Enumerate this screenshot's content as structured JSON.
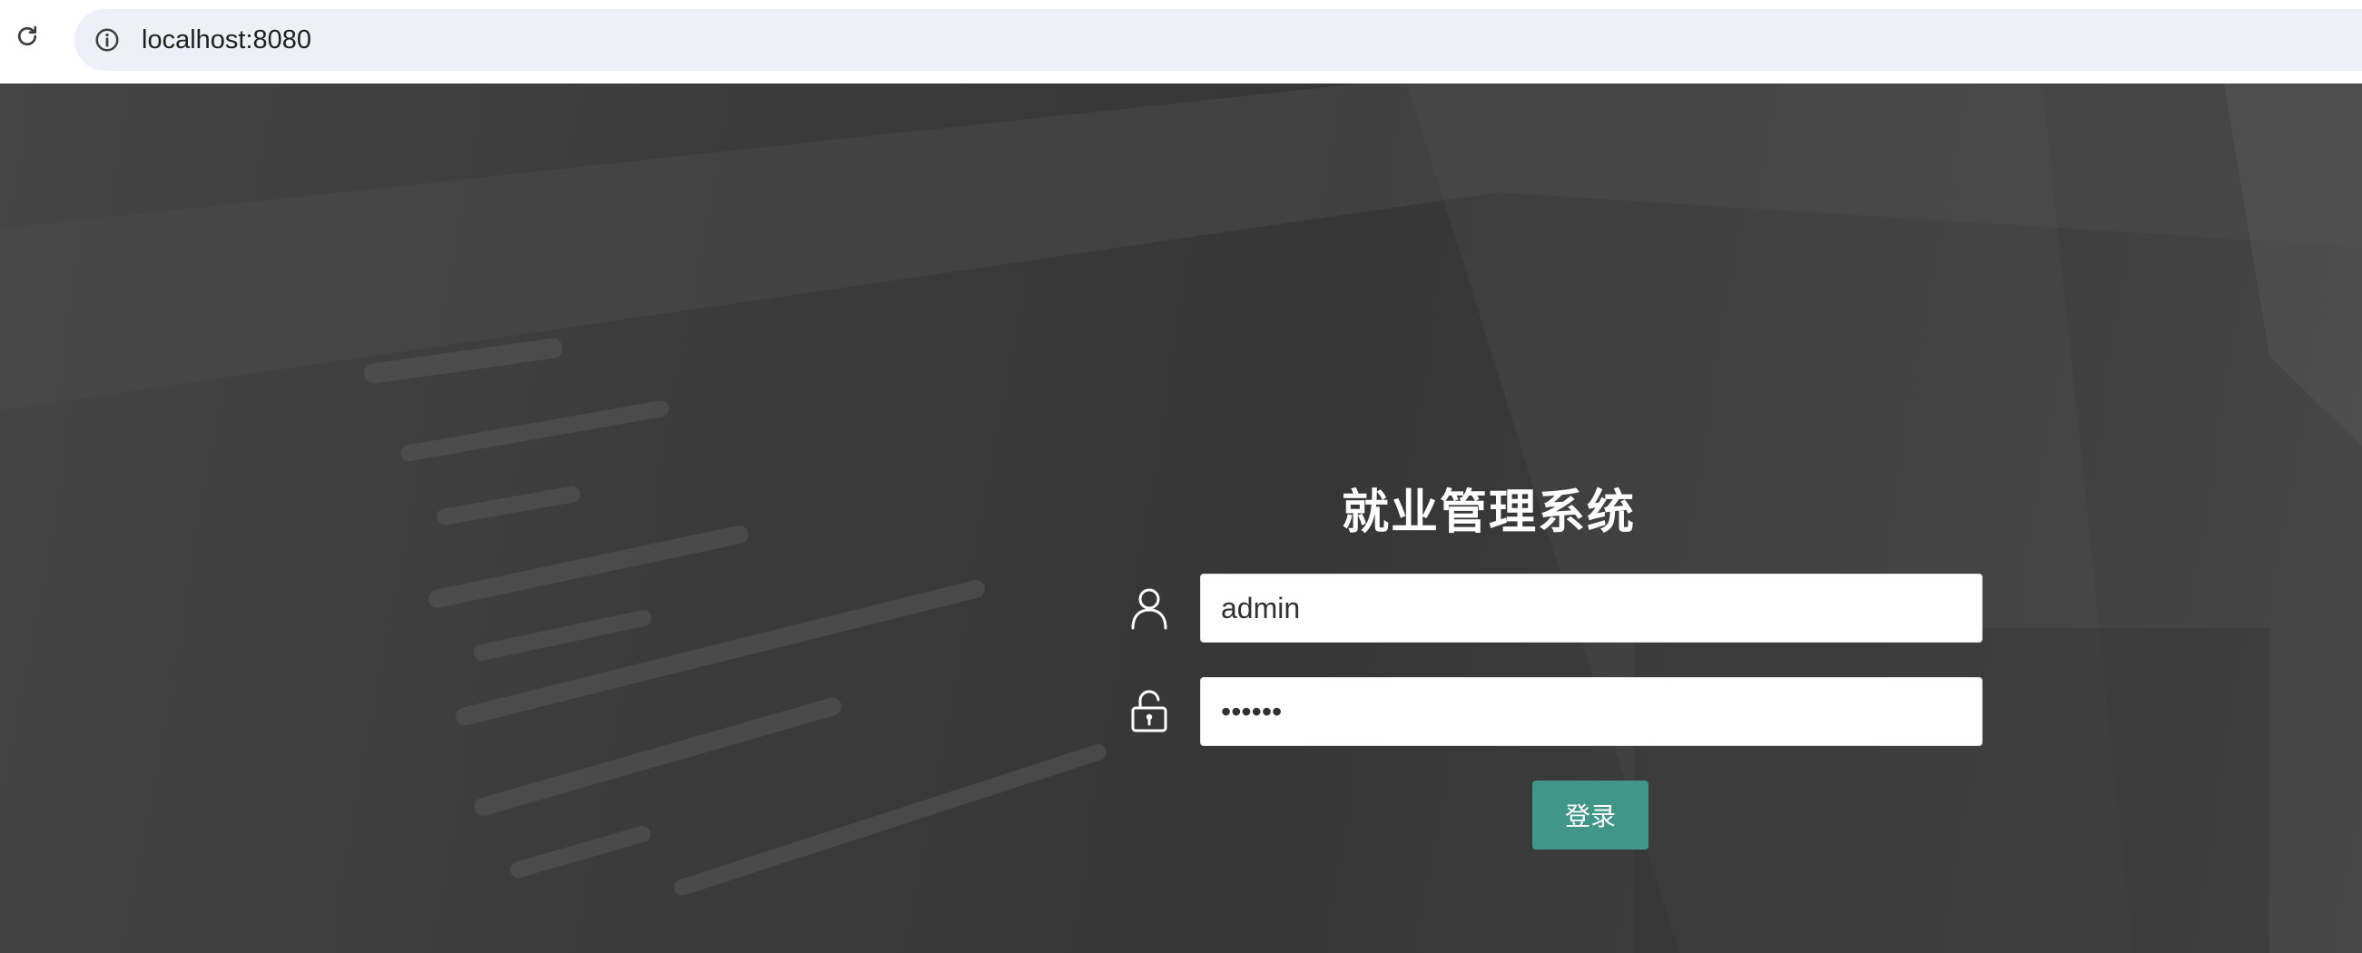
{
  "browser": {
    "url": "localhost:8080",
    "icons": {
      "reload": "reload-icon",
      "info": "info-icon"
    }
  },
  "login": {
    "title": "就业管理系统",
    "username_value": "admin",
    "password_value": "••••••",
    "submit_label": "登录",
    "icons": {
      "user": "user-icon",
      "lock": "lock-icon"
    }
  },
  "colors": {
    "accent": "#41968a",
    "background": "#3c3c3c",
    "omnibox": "#edf0f7"
  }
}
